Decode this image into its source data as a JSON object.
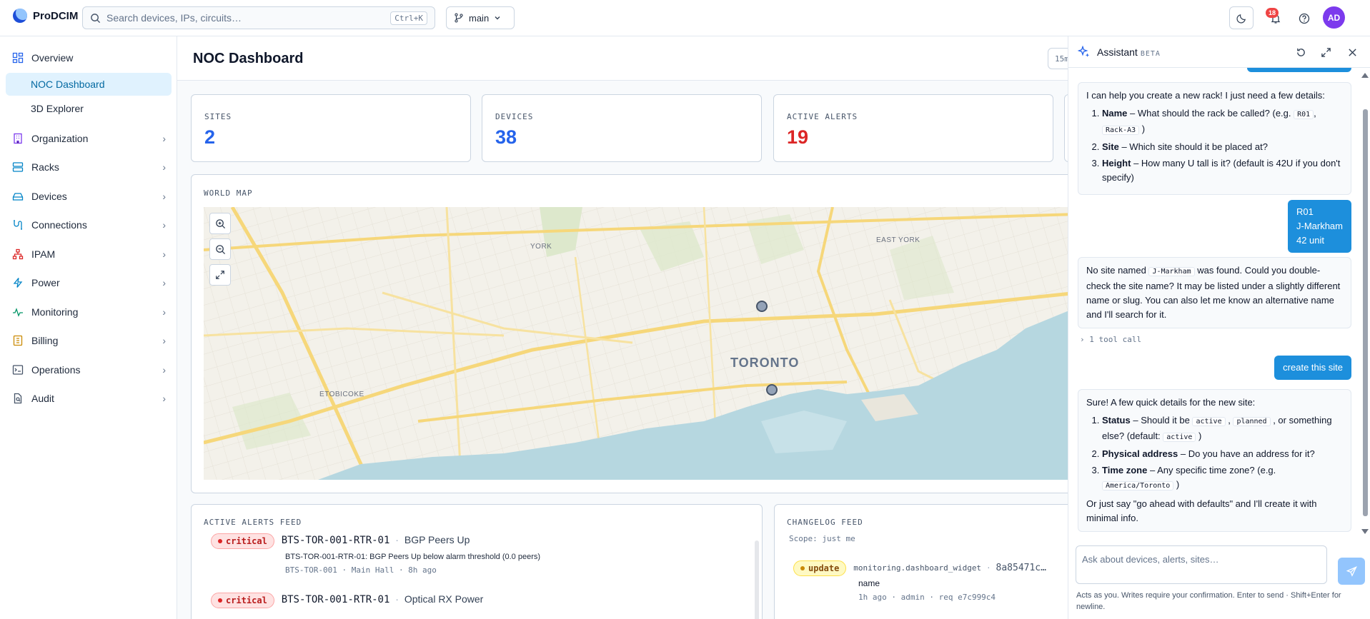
{
  "app": {
    "name": "ProDCIM"
  },
  "search": {
    "placeholder": "Search devices, IPs, circuits…",
    "shortcut": "Ctrl+K"
  },
  "branch": {
    "label": "main"
  },
  "notifications": {
    "count": "18"
  },
  "user": {
    "initials": "AD"
  },
  "sidebar": {
    "items": [
      {
        "label": "Overview"
      },
      {
        "label": "NOC Dashboard"
      },
      {
        "label": "3D Explorer"
      },
      {
        "label": "Organization"
      },
      {
        "label": "Racks"
      },
      {
        "label": "Devices"
      },
      {
        "label": "Connections"
      },
      {
        "label": "IPAM"
      },
      {
        "label": "Power"
      },
      {
        "label": "Monitoring"
      },
      {
        "label": "Billing"
      },
      {
        "label": "Operations"
      },
      {
        "label": "Audit"
      }
    ]
  },
  "page": {
    "title": "NOC Dashboard",
    "time_range": "15m"
  },
  "stats": [
    {
      "label": "SITES",
      "value": "2",
      "color": "#2563eb"
    },
    {
      "label": "DEVICES",
      "value": "38",
      "color": "#2563eb"
    },
    {
      "label": "ACTIVE ALERTS",
      "value": "19",
      "color": "#dc2626"
    }
  ],
  "map": {
    "label": "WORLD MAP",
    "places": {
      "york": "YORK",
      "east_york": "EAST YORK",
      "toronto": "TORONTO",
      "etobicoke": "ETOBICOKE"
    }
  },
  "alerts_feed": {
    "label": "ACTIVE ALERTS FEED",
    "items": [
      {
        "severity": "critical",
        "device": "BTS-TOR-001-RTR-01",
        "name": "BGP Peers Up",
        "description": "BTS-TOR-001-RTR-01: BGP Peers Up below alarm threshold (0.0 peers)",
        "meta": "BTS-TOR-001 · Main Hall · 8h ago"
      },
      {
        "severity": "critical",
        "device": "BTS-TOR-001-RTR-01",
        "name": "Optical RX Power"
      }
    ]
  },
  "changelog": {
    "label": "CHANGELOG FEED",
    "scope": "Scope: just me",
    "items": [
      {
        "action": "update",
        "object": "monitoring.dashboard_widget",
        "hash": "8a85471c…",
        "field": "name",
        "meta": "1h ago · admin · req e7c999c4"
      }
    ]
  },
  "assistant": {
    "title": "Assistant",
    "beta": "BETA",
    "messages": {
      "m1": {
        "intro": "I can help you create a new rack! I just need a few details:",
        "i1_b": "Name",
        "i1_t": " – What should the rack be called? (e.g. ",
        "i1_c1": "R01",
        "i1_s": ", ",
        "i1_c2": "Rack-A3",
        "i1_e": " )",
        "i2_b": "Site",
        "i2_t": " – Which site should it be placed at?",
        "i3_b": "Height",
        "i3_t": " – How many U tall is it? (default is 42U if you don't specify)"
      },
      "u1": {
        "l1": "R01",
        "l2": "J-Markham",
        "l3": "42 unit"
      },
      "m2": {
        "t1": "No site named ",
        "code": "J-Markham",
        "t2": " was found. Could you double-check the site name? It may be listed under a slightly different name or slug. You can also let me know an alternative name and I'll search for it."
      },
      "tool_call": "1 tool call",
      "u2": "create this site",
      "m3": {
        "intro": "Sure! A few quick details for the new site:",
        "i1_b": "Status",
        "i1_t": " – Should it be ",
        "i1_c1": "active",
        "i1_s": " , ",
        "i1_c2": "planned",
        "i1_t2": " , or something else? (default: ",
        "i1_c3": "active",
        "i1_e": " )",
        "i2_b": "Physical address",
        "i2_t": " – Do you have an address for it?",
        "i3_b": "Time zone",
        "i3_t": " – Any specific time zone? (e.g. ",
        "i3_c": "America/Toronto",
        "i3_e": " )",
        "outro": "Or just say \"go ahead with defaults\" and I'll create it with minimal info."
      }
    },
    "input_placeholder": "Ask about devices, alerts, sites…",
    "footer": "Acts as you. Writes require your confirmation. Enter to send · Shift+Enter for newline."
  }
}
